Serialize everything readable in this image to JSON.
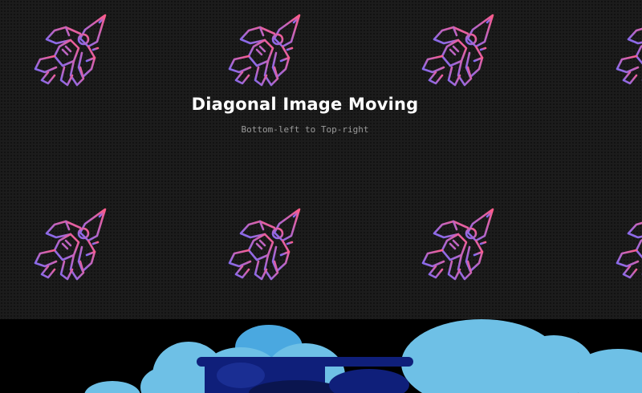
{
  "hero": {
    "title": "Diagonal Image Moving",
    "subtitle": "Bottom-left to Top-right"
  },
  "icons": {
    "pattern_icon": "fighter-jet-icon",
    "gradient_colors": [
      "#ff5c8a",
      "#7b6cf6"
    ],
    "shadow_color": "#000000"
  },
  "colors": {
    "panel_background": "#1c1c1c",
    "title_color": "#ffffff",
    "subtitle_color": "#9a9a9a",
    "sky_background": "#000000",
    "cloud_light": "#6ec0e6",
    "cloud_mid": "#4aa8e0",
    "cloud_dark": "#0f1f7a"
  }
}
